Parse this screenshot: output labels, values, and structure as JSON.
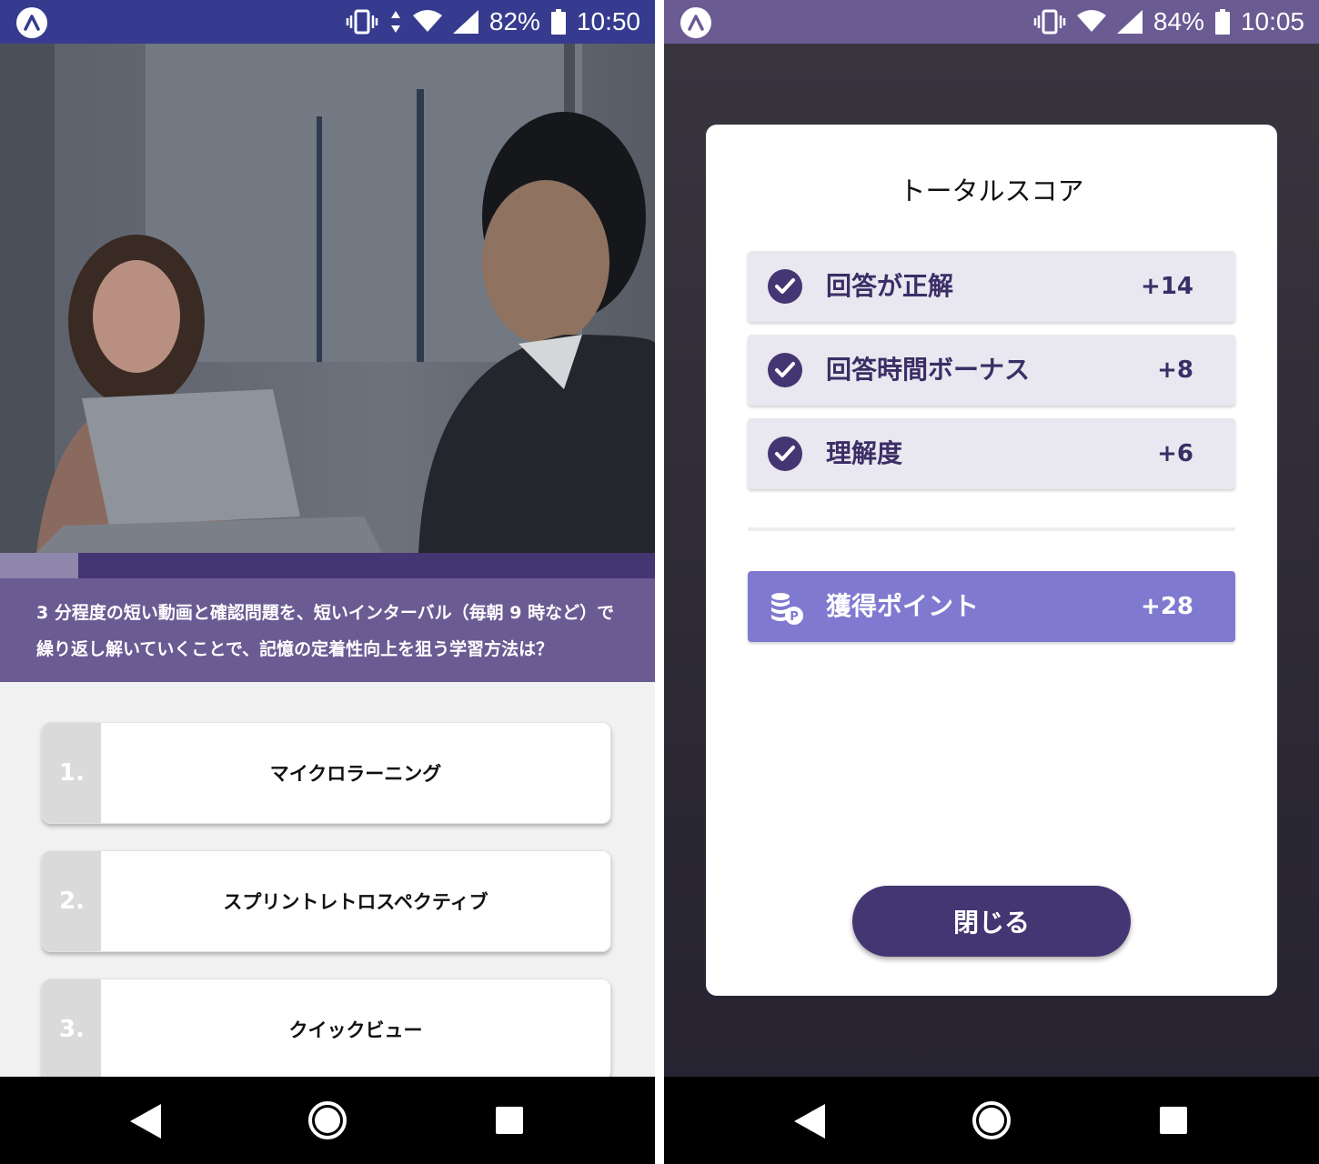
{
  "left_screen": {
    "status": {
      "battery": "82%",
      "time": "10:50"
    },
    "progress_fraction": 0.12,
    "question": "3 分程度の短い動画と確認問題を、短いインターバル（毎朝 9 時など）で繰り返し解いていくことで、記憶の定着性向上を狙う学習方法は？",
    "choices": [
      {
        "number": "1.",
        "label": "マイクロラーニング"
      },
      {
        "number": "2.",
        "label": "スプリントレトロスペクティブ"
      },
      {
        "number": "3.",
        "label": "クイックビュー"
      }
    ]
  },
  "right_screen": {
    "status": {
      "battery": "84%",
      "time": "10:05"
    },
    "title": "トータルスコア",
    "rows": [
      {
        "label": "回答が正解",
        "value": "+14"
      },
      {
        "label": "回答時間ボーナス",
        "value": "+8"
      },
      {
        "label": "理解度",
        "value": "+6"
      }
    ],
    "points": {
      "label": "獲得ポイント",
      "value": "+28"
    },
    "close_label": "閉じる"
  },
  "colors": {
    "accent_dark": "#433672",
    "accent_mid": "#6a5b93",
    "points_bg": "#8079d0",
    "status_left": "#363b8f"
  },
  "icons": [
    "app-logo-icon",
    "vibrate-icon",
    "data-arrows-icon",
    "wifi-icon",
    "signal-icon",
    "battery-icon",
    "check-circle-icon",
    "coins-icon",
    "back-icon",
    "home-icon",
    "recents-icon"
  ]
}
